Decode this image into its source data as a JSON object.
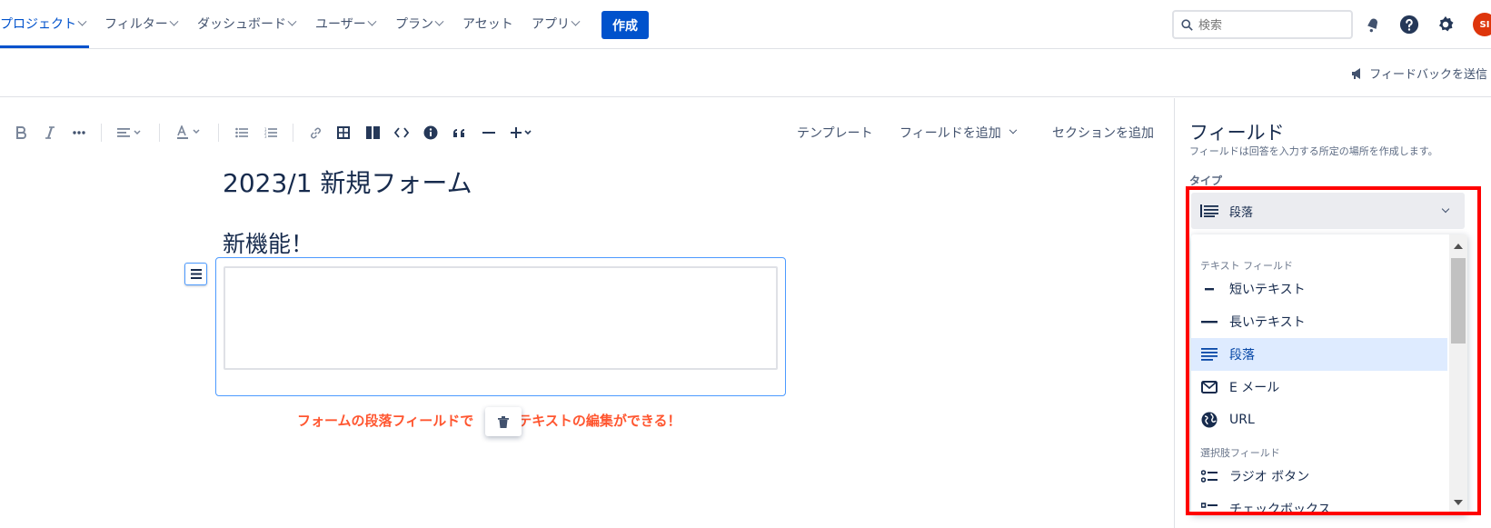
{
  "topnav": {
    "items": [
      {
        "label": "プロジェクト",
        "active": true
      },
      {
        "label": "フィルター"
      },
      {
        "label": "ダッシュボード"
      },
      {
        "label": "ユーザー"
      },
      {
        "label": "プラン"
      },
      {
        "label": "アセット"
      },
      {
        "label": "アプリ"
      }
    ],
    "create_label": "作成",
    "search_placeholder": "検索",
    "avatar_initials": "SI"
  },
  "subbar": {
    "feedback_label": "フィードバックを送信"
  },
  "toolbar": {
    "template_label": "テンプレート",
    "add_field_label": "フィールドを追加",
    "add_section_label": "セクションを追加"
  },
  "form": {
    "title": "2023/1 新規フォーム",
    "heading": "新機能！",
    "annotation_left": "フォームの段落フィールドで",
    "annotation_right": "チテキストの編集ができる！"
  },
  "panel": {
    "title": "フィールド",
    "subtitle": "フィールドは回答を入力する所定の場所を作成します。",
    "type_label": "タイプ",
    "type_value": "段落",
    "groups": {
      "text": "テキスト フィールド",
      "choice": "選択肢フィールド"
    },
    "items": {
      "short": "短いテキスト",
      "long": "長いテキスト",
      "paragraph": "段落",
      "email": "E メール",
      "url": "URL",
      "radio": "ラジオ ボタン",
      "checkbox": "チェックボックス"
    }
  },
  "colors": {
    "brand": "#0052cc",
    "annotation": "#ff5630",
    "highlight": "#ff0000",
    "selected_bg": "#deebff"
  }
}
